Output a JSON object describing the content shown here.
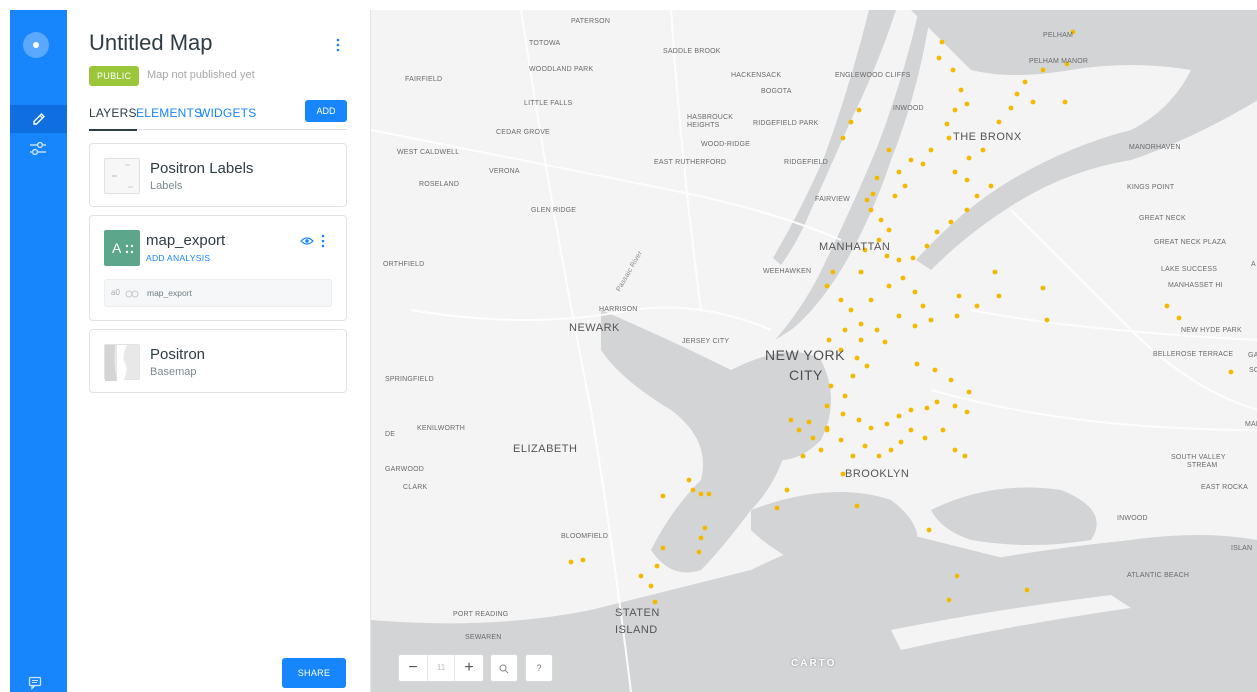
{
  "rail": {
    "icons": [
      "carto-logo-icon",
      "pencil-icon",
      "sliders-icon",
      "feedback-icon"
    ],
    "accent": "#1785fb"
  },
  "panel": {
    "title": "Untitled Map",
    "badge": "PUBLIC",
    "publish_status": "Map not published yet",
    "tabs": [
      {
        "label": "LAYERS",
        "active": true
      },
      {
        "label": "ELEMENTS",
        "active": false
      },
      {
        "label": "WIDGETS",
        "active": false
      }
    ],
    "add_label": "ADD",
    "share_label": "SHARE"
  },
  "layers": [
    {
      "title": "Positron Labels",
      "subtitle": "Labels"
    },
    {
      "title": "map_export",
      "thumb_letter": "A",
      "analysis_link": "ADD ANALYSIS",
      "source_node": "a0",
      "source_name": "map_export",
      "thumb_color": "#5ca68b"
    },
    {
      "title": "Positron",
      "subtitle": "Basemap"
    }
  ],
  "map": {
    "zoom_level": "11",
    "zoom_out": "−",
    "zoom_in": "+",
    "help": "?",
    "attribution": "CARTO",
    "point_color": "#f5b800",
    "labels": [
      {
        "text": "PATERSON",
        "size": "s"
      },
      {
        "text": "TOTOWA",
        "size": "s"
      },
      {
        "text": "SADDLE BROOK",
        "size": "s"
      },
      {
        "text": "PELHAM",
        "size": "s"
      },
      {
        "text": "WOODLAND PARK",
        "size": "s"
      },
      {
        "text": "HACKENSACK",
        "size": "s"
      },
      {
        "text": "ENGLEWOOD CLIFFS",
        "size": "s"
      },
      {
        "text": "PELHAM MANOR",
        "size": "s"
      },
      {
        "text": "FAIRFIELD",
        "size": "s"
      },
      {
        "text": "BOGOTA",
        "size": "s"
      },
      {
        "text": "LITTLE FALLS",
        "size": "s"
      },
      {
        "text": "INWOOD",
        "size": "s"
      },
      {
        "text": "HASBROUCK",
        "size": "s"
      },
      {
        "text": "HEIGHTS",
        "size": "s"
      },
      {
        "text": "RIDGEFIELD PARK",
        "size": "s"
      },
      {
        "text": "CEDAR GROVE",
        "size": "s"
      },
      {
        "text": "THE BRONX",
        "size": "m"
      },
      {
        "text": "WOOD-RIDGE",
        "size": "s"
      },
      {
        "text": "WEST CALDWELL",
        "size": "s"
      },
      {
        "text": "MANORHAVEN",
        "size": "s"
      },
      {
        "text": "EAST RUTHERFORD",
        "size": "s"
      },
      {
        "text": "RIDGEFIELD",
        "size": "s"
      },
      {
        "text": "VERONA",
        "size": "s"
      },
      {
        "text": "ROSELAND",
        "size": "s"
      },
      {
        "text": "FAIRVIEW",
        "size": "s"
      },
      {
        "text": "KINGS POINT",
        "size": "s"
      },
      {
        "text": "GLEN RIDGE",
        "size": "s"
      },
      {
        "text": "GREAT NECK",
        "size": "s"
      },
      {
        "text": "MANHATTAN",
        "size": "m"
      },
      {
        "text": "GREAT NECK PLAZA",
        "size": "s"
      },
      {
        "text": "ORTHFIELD",
        "size": "s"
      },
      {
        "text": "WEEHAWKEN",
        "size": "s"
      },
      {
        "text": "LAKE SUCCESS",
        "size": "s"
      },
      {
        "text": "A",
        "size": "s"
      },
      {
        "text": "MANHASSET HI",
        "size": "s"
      },
      {
        "text": "HARRISON",
        "size": "s"
      },
      {
        "text": "NEWARK",
        "size": "m"
      },
      {
        "text": "NEW HYDE PARK",
        "size": "s"
      },
      {
        "text": "JERSEY CITY",
        "size": "s"
      },
      {
        "text": "NEW YORK",
        "size": "l"
      },
      {
        "text": "CITY",
        "size": "l"
      },
      {
        "text": "BELLEROSE TERRACE",
        "size": "s"
      },
      {
        "text": "GARDEN",
        "size": "s"
      },
      {
        "text": "SOU",
        "size": "s"
      },
      {
        "text": "SPRINGFIELD",
        "size": "s"
      },
      {
        "text": "KENILWORTH",
        "size": "s"
      },
      {
        "text": "DE",
        "size": "s"
      },
      {
        "text": "MALVERNE",
        "size": "s"
      },
      {
        "text": "ELIZABETH",
        "size": "m"
      },
      {
        "text": "SOUTH VALLEY",
        "size": "s"
      },
      {
        "text": "STREAM",
        "size": "s"
      },
      {
        "text": "GARWOOD",
        "size": "s"
      },
      {
        "text": "BROOKLYN",
        "size": "m"
      },
      {
        "text": "CLARK",
        "size": "s"
      },
      {
        "text": "EAST ROCKA",
        "size": "s"
      },
      {
        "text": "INWOOD",
        "size": "s"
      },
      {
        "text": "BLOOMFIELD",
        "size": "s"
      },
      {
        "text": "ISLAN",
        "size": "s"
      },
      {
        "text": "ATLANTIC BEACH",
        "size": "s"
      },
      {
        "text": "PORT READING",
        "size": "s"
      },
      {
        "text": "STATEN",
        "size": "m"
      },
      {
        "text": "ISLAND",
        "size": "m"
      },
      {
        "text": "SEWAREN",
        "size": "s"
      },
      {
        "text": "Passaic River",
        "size": "river"
      }
    ]
  }
}
